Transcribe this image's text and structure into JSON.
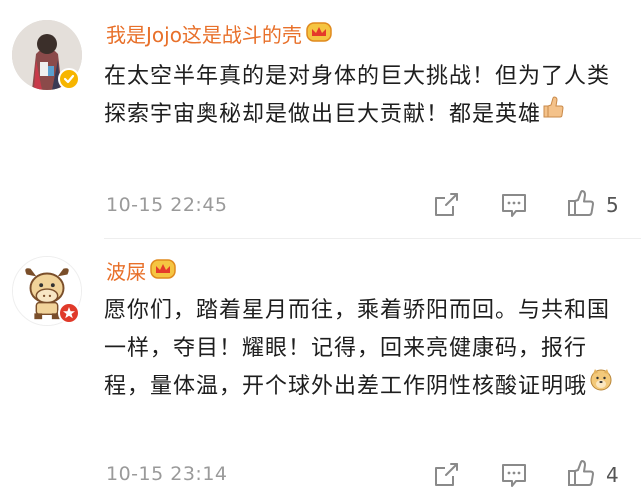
{
  "comments": [
    {
      "username": "我是Jojo这是战斗的壳",
      "text": "在太空半年真的是对身体的巨大挑战！但为了人类探索宇宙奥秘却是做出巨大贡献！都是英雄",
      "emoji": "thumbs-up-emoji",
      "timestamp": "10-15 22:45",
      "likes": "5",
      "avatar_badge": "verified-yellow-badge"
    },
    {
      "username": "波屎",
      "text": "愿你们，踏着星月而往，乘着骄阳而回。与共和国一样，夺目！耀眼！记得，回来亮健康码，报行程，量体温，开个球外出差工作阴性核酸证明哦",
      "emoji": "doge-emoji",
      "timestamp": "10-15 23:14",
      "likes": "4",
      "avatar_badge": "red-star-badge"
    }
  ],
  "colors": {
    "username": "#e8702a",
    "timestamp": "#9a9a9a",
    "icon": "#8a8a8a"
  }
}
